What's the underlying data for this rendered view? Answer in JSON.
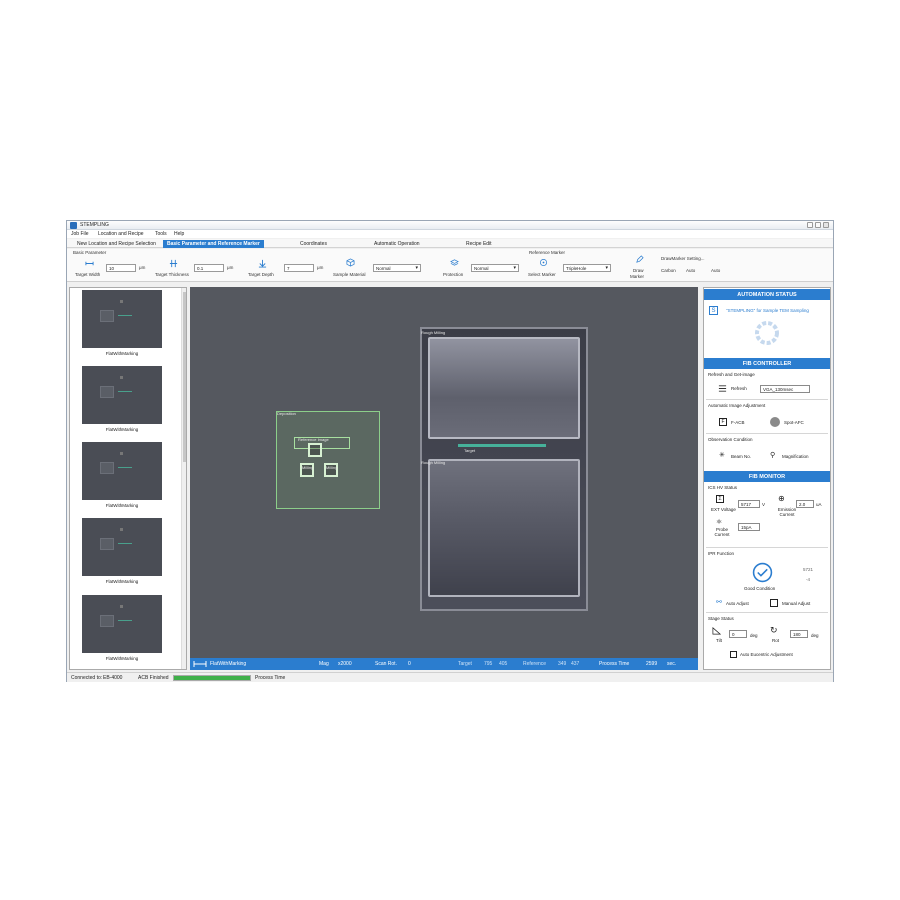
{
  "window": {
    "title": "STEMPLING"
  },
  "menu": [
    "Job File",
    "Location and Recipe",
    "Tools",
    "Help"
  ],
  "tabs": [
    {
      "label": "New Location and Recipe Selection",
      "active": false
    },
    {
      "label": "Basic Parameter and Reference Marker",
      "active": true
    },
    {
      "label": "Coordinates",
      "active": false
    },
    {
      "label": "Automatic Operation",
      "active": false
    },
    {
      "label": "Recipe Edit",
      "active": false
    }
  ],
  "ribbon": {
    "basic_group": "Basic Parameter",
    "target_width": {
      "label": "Target Width",
      "value": "10",
      "unit": "μm"
    },
    "target_thickness": {
      "label": "Target Thickness",
      "value": "0.1",
      "unit": "μm"
    },
    "target_depth": {
      "label": "Target Depth",
      "value": "7",
      "unit": "μm"
    },
    "sample_material": {
      "label": "Sample Material",
      "value": "Normal"
    },
    "protection": {
      "label": "Protection",
      "value": "Normal"
    },
    "ref_group": "Reference Marker",
    "select_marker": {
      "label": "Select Marker",
      "value": "TripleHole"
    },
    "draw_marker": {
      "label1": "Draw",
      "label2": "Marker"
    },
    "draw_marker_setting": "DrawMarker Setting...",
    "modes": [
      "Carbon",
      "Auto",
      "Auto"
    ]
  },
  "thumbnails": {
    "label": "FlatWithMarking",
    "items": [
      {
        "label": "FlatWithMarking"
      },
      {
        "label": "FlatWithMarking"
      },
      {
        "label": "FlatWithMarking"
      },
      {
        "label": "FlatWithMarking"
      },
      {
        "label": "FlatWithMarking"
      }
    ]
  },
  "viewer": {
    "labels": {
      "deposition": "Deposition",
      "reference_image": "Reference Image",
      "milling": "Milling",
      "target": "Target",
      "rough_milling_top": "Rough Milling",
      "rough_milling_bottom": "Rough Milling"
    },
    "status": {
      "mode": "FlatWithMarking",
      "mag_label": "Mag",
      "mag_value": "x2000",
      "scan_label": "Scan Rot.",
      "scan_value": "0",
      "target_label": "Target",
      "target_x": "795",
      "target_y": "405",
      "reference_label": "Reference",
      "reference_x": "349",
      "reference_y": "437",
      "process_label": "Process Time",
      "process_value": "2599",
      "process_unit": "sec."
    }
  },
  "statusbar": {
    "connected_label": "Connected to:",
    "connected_value": "EB-4000",
    "acb_label": "ACB Finished",
    "progress_fraction": 1.0,
    "process_time_label": "Process Time"
  },
  "right_panel": {
    "automation_status": {
      "header": "AUTOMATION STATUS",
      "text": "\"STEMPLING\" for Sample TEM Sampling"
    },
    "fib_controller": {
      "header": "FIB CONTROLLER",
      "refresh_group": "Refresh and Get-image",
      "refresh_label": "Refresh",
      "refresh_value": "VGA_130msec",
      "auto_adjust_group": "Automatic Image Adjustment",
      "f_acb": "F-ACB",
      "spot_afc": "Spot-AFC",
      "observation_group": "Observation Condition",
      "beam_no": "Beam No.",
      "magnification": "Magnification"
    },
    "fib_monitor": {
      "header": "FIB MONITOR",
      "hv_group": "ICS HV Status",
      "ext_voltage_label": "EXT Voltage",
      "ext_voltage_value": "5717",
      "ext_voltage_unit": "V",
      "emission_label": "Emission Current",
      "emission_value": "2.0",
      "emission_unit": "uA",
      "probe_label": "Probe Current",
      "probe_value": "15pA",
      "ipr_group": "IPR Function",
      "condition": "Good Condition",
      "ipr_value1": "5721",
      "ipr_value2": "-4",
      "auto_adjust": "Auto Adjust",
      "manual_adjust": "Manual Adjust",
      "stage_group": "Stage Status",
      "tilt_label": "Tilt",
      "tilt_value": "0",
      "tilt_unit": "deg",
      "rot_label": "Rot",
      "rot_value": "180",
      "rot_unit": "deg",
      "eucentric": "Auto Eucentric Adjustment"
    }
  },
  "colors": {
    "accent": "#2b7dcf",
    "marker": "#8ccf8a",
    "lamella": "#46b19a",
    "progress": "#3fb04a"
  }
}
